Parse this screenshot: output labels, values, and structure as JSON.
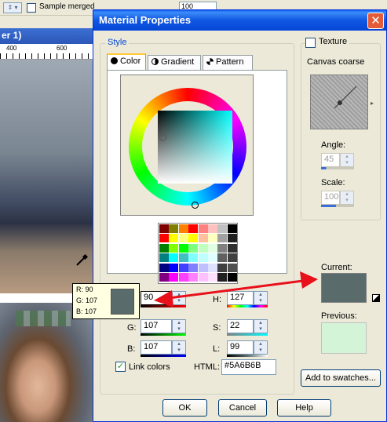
{
  "background_app": {
    "sample_merged_label": "Sample merged",
    "zoom_value": "100",
    "doc_title": "er 1)",
    "ruler_marks": [
      "400",
      "600"
    ]
  },
  "dialog": {
    "title": "Material Properties",
    "close_symbol": "✕",
    "style_group_label": "Style",
    "tabs": [
      {
        "label": "Color",
        "icon": "color-circle-icon"
      },
      {
        "label": "Gradient",
        "icon": "gradient-icon"
      },
      {
        "label": "Pattern",
        "icon": "pattern-icon"
      }
    ],
    "texture": {
      "checkbox_label": "Texture",
      "checked": false,
      "name": "Canvas coarse",
      "angle_label": "Angle:",
      "angle_value": "45",
      "scale_label": "Scale:",
      "scale_value": "100"
    },
    "fields": {
      "r_label": "R:",
      "r_value": "90",
      "g_label": "G:",
      "g_value": "107",
      "b_label": "B:",
      "b_value": "107",
      "h_label": "H:",
      "h_value": "127",
      "s_label": "S:",
      "s_value": "22",
      "l_label": "L:",
      "l_value": "99"
    },
    "link_colors_label": "Link colors",
    "link_colors_checked": true,
    "html_label": "HTML:",
    "html_value": "#5A6B6B",
    "current_label": "Current:",
    "current_color": "#5a6b6b",
    "previous_label": "Previous:",
    "previous_color": "#d4f4d8",
    "add_to_swatches_label": "Add to swatches...",
    "ok_label": "OK",
    "cancel_label": "Cancel",
    "help_label": "Help"
  },
  "tooltip": {
    "r_line": "R: 90",
    "g_line": "G: 107",
    "b_line": "B: 107",
    "swatch_color": "#5a6b6b"
  },
  "annotation": {
    "arrow_color": "#e8101a"
  },
  "swatch_palette": [
    [
      "#800000",
      "#808000",
      "#ff8000",
      "#ff0000",
      "#ff8080",
      "#ffc0c0",
      "#c0c0c0",
      "#000000"
    ],
    [
      "#ff0000",
      "#ffff00",
      "#ffff80",
      "#ffff00",
      "#ffc0a0",
      "#ffffc0",
      "#a0a0a0",
      "#202020"
    ],
    [
      "#008000",
      "#80ff00",
      "#00ff00",
      "#80ff80",
      "#c0ffc0",
      "#e0ffe0",
      "#808080",
      "#303030"
    ],
    [
      "#008080",
      "#00ffff",
      "#40c0c0",
      "#80ffff",
      "#c0ffff",
      "#e0ffff",
      "#606060",
      "#404040"
    ],
    [
      "#000080",
      "#0000ff",
      "#4040ff",
      "#8080ff",
      "#c0c0ff",
      "#e0e0ff",
      "#404040",
      "#505050"
    ],
    [
      "#800080",
      "#ff00ff",
      "#ff40ff",
      "#ff80ff",
      "#ffc0ff",
      "#ffe0ff",
      "#202020",
      "#000000"
    ]
  ]
}
